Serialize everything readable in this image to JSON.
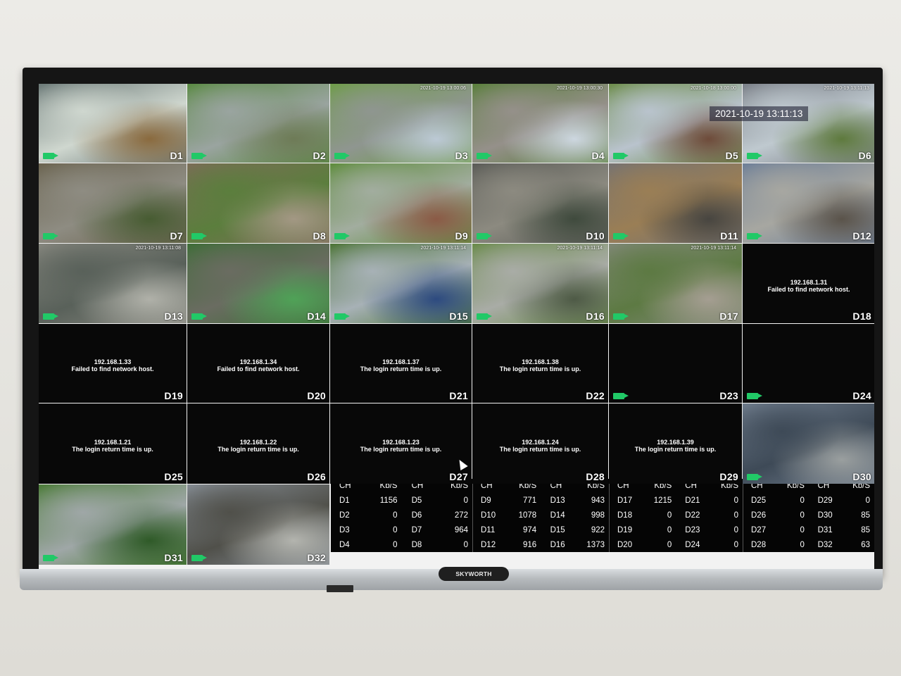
{
  "timestamp_overlay": "2021-10-19 13:11:13",
  "brand": "SKYWORTH",
  "feeds": [
    {
      "label": "D1",
      "type": "video",
      "colors": [
        "#6c7a78",
        "#cfd7cf",
        "#8a6a3e"
      ],
      "ts": ""
    },
    {
      "label": "D2",
      "type": "video",
      "colors": [
        "#5a8a43",
        "#9aa4a0",
        "#6e7b57"
      ],
      "ts": ""
    },
    {
      "label": "D3",
      "type": "video",
      "colors": [
        "#6f9c4a",
        "#8f9690",
        "#bcc9d5"
      ],
      "ts": "2021-10-19 13:00:06"
    },
    {
      "label": "D4",
      "type": "video",
      "colors": [
        "#5a7f3c",
        "#95908a",
        "#cdd7e0"
      ],
      "ts": "2021-10-19 13:00:30"
    },
    {
      "label": "D5",
      "type": "video",
      "colors": [
        "#6d8d4b",
        "#b9c3cd",
        "#6e4b3a"
      ],
      "ts": "2021-10-18 13:00:00"
    },
    {
      "label": "D6",
      "type": "video",
      "colors": [
        "#7b8088",
        "#bfc9cf",
        "#5e7a3d"
      ],
      "ts": "2021-10-19 13:11:13"
    },
    {
      "label": "D7",
      "type": "video",
      "colors": [
        "#6b6450",
        "#8e8c82",
        "#475c32"
      ],
      "ts": ""
    },
    {
      "label": "D8",
      "type": "video",
      "colors": [
        "#7a6d56",
        "#5b7e3d",
        "#a39884"
      ],
      "ts": ""
    },
    {
      "label": "D9",
      "type": "video",
      "colors": [
        "#5f8d3e",
        "#a2ad9f",
        "#8b5a46"
      ],
      "ts": ""
    },
    {
      "label": "D10",
      "type": "video",
      "colors": [
        "#5b5c57",
        "#8c8a80",
        "#3f4a3d"
      ],
      "ts": ""
    },
    {
      "label": "D11",
      "type": "video",
      "colors": [
        "#767371",
        "#9a7e55",
        "#474540"
      ],
      "ts": ""
    },
    {
      "label": "D12",
      "type": "video",
      "colors": [
        "#6f8098",
        "#a7a7a1",
        "#5a534a"
      ],
      "ts": ""
    },
    {
      "label": "D13",
      "type": "video",
      "colors": [
        "#84857d",
        "#59615a",
        "#b0b1a9"
      ],
      "ts": "2021-10-19 13:11:08"
    },
    {
      "label": "D14",
      "type": "video",
      "colors": [
        "#3f6d38",
        "#6a6c61",
        "#4fa257"
      ],
      "ts": ""
    },
    {
      "label": "D15",
      "type": "video",
      "colors": [
        "#4d7537",
        "#a7b1b6",
        "#2d4a80"
      ],
      "ts": "2021-10-19 13:11:14"
    },
    {
      "label": "D16",
      "type": "video",
      "colors": [
        "#6a8b4b",
        "#a9aca6",
        "#4e5a46"
      ],
      "ts": "2021-10-19 13:11:14"
    },
    {
      "label": "D17",
      "type": "video",
      "colors": [
        "#7f8775",
        "#5d7a43",
        "#a59e92"
      ],
      "ts": "2021-10-19 13:11:14"
    },
    {
      "label": "D18",
      "type": "error",
      "ip": "192.168.1.31",
      "msg": "Failed to find network host."
    },
    {
      "label": "D19",
      "type": "error",
      "ip": "192.168.1.33",
      "msg": "Failed to find network host."
    },
    {
      "label": "D20",
      "type": "error",
      "ip": "192.168.1.34",
      "msg": "Failed to find network host."
    },
    {
      "label": "D21",
      "type": "error",
      "ip": "192.168.1.37",
      "msg": "The login return time is up."
    },
    {
      "label": "D22",
      "type": "error",
      "ip": "192.168.1.38",
      "msg": "The login return time is up."
    },
    {
      "label": "D23",
      "type": "blank"
    },
    {
      "label": "D24",
      "type": "blank"
    },
    {
      "label": "D25",
      "type": "error",
      "ip": "192.168.1.21",
      "msg": "The login return time is up."
    },
    {
      "label": "D26",
      "type": "error",
      "ip": "192.168.1.22",
      "msg": "The login return time is up."
    },
    {
      "label": "D27",
      "type": "error",
      "ip": "192.168.1.23",
      "msg": "The login return time is up."
    },
    {
      "label": "D28",
      "type": "error",
      "ip": "192.168.1.24",
      "msg": "The login return time is up."
    },
    {
      "label": "D29",
      "type": "error",
      "ip": "192.168.1.39",
      "msg": "The login return time is up."
    },
    {
      "label": "D30",
      "type": "video",
      "colors": [
        "#6d7a8a",
        "#3e4a57",
        "#9a9f9f"
      ],
      "ts": ""
    },
    {
      "label": "D31",
      "type": "video",
      "colors": [
        "#4c7c39",
        "#9fa7a7",
        "#2f5a28"
      ],
      "ts": ""
    },
    {
      "label": "D32",
      "type": "video",
      "colors": [
        "#838a91",
        "#50504a",
        "#b3b4ae"
      ],
      "ts": ""
    }
  ],
  "stats": {
    "headers": [
      "CH",
      "Kb/S",
      "CH",
      "Kb/S"
    ],
    "blocks": [
      [
        [
          "D1",
          "1156",
          "D5",
          "0"
        ],
        [
          "D2",
          "0",
          "D6",
          "272"
        ],
        [
          "D3",
          "0",
          "D7",
          "964"
        ],
        [
          "D4",
          "0",
          "D8",
          "0"
        ]
      ],
      [
        [
          "D9",
          "771",
          "D13",
          "943"
        ],
        [
          "D10",
          "1078",
          "D14",
          "998"
        ],
        [
          "D11",
          "974",
          "D15",
          "922"
        ],
        [
          "D12",
          "916",
          "D16",
          "1373"
        ]
      ],
      [
        [
          "D17",
          "1215",
          "D21",
          "0"
        ],
        [
          "D18",
          "0",
          "D22",
          "0"
        ],
        [
          "D19",
          "0",
          "D23",
          "0"
        ],
        [
          "D20",
          "0",
          "D24",
          "0"
        ]
      ],
      [
        [
          "D25",
          "0",
          "D29",
          "0"
        ],
        [
          "D26",
          "0",
          "D30",
          "85"
        ],
        [
          "D27",
          "0",
          "D31",
          "85"
        ],
        [
          "D28",
          "0",
          "D32",
          "63"
        ]
      ]
    ]
  }
}
